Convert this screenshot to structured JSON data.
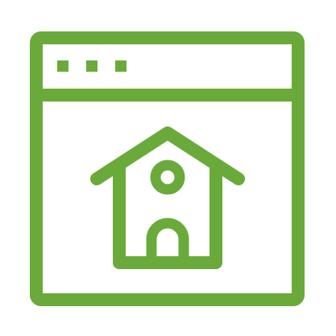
{
  "icon": {
    "name": "browser-window-home-icon",
    "colors": {
      "stroke": "#6aaa3a",
      "background": "#ffffff"
    },
    "parts": {
      "window": "browser-window-frame",
      "dots": [
        "window-dot-1",
        "window-dot-2",
        "window-dot-3"
      ],
      "house": "house-icon"
    }
  }
}
